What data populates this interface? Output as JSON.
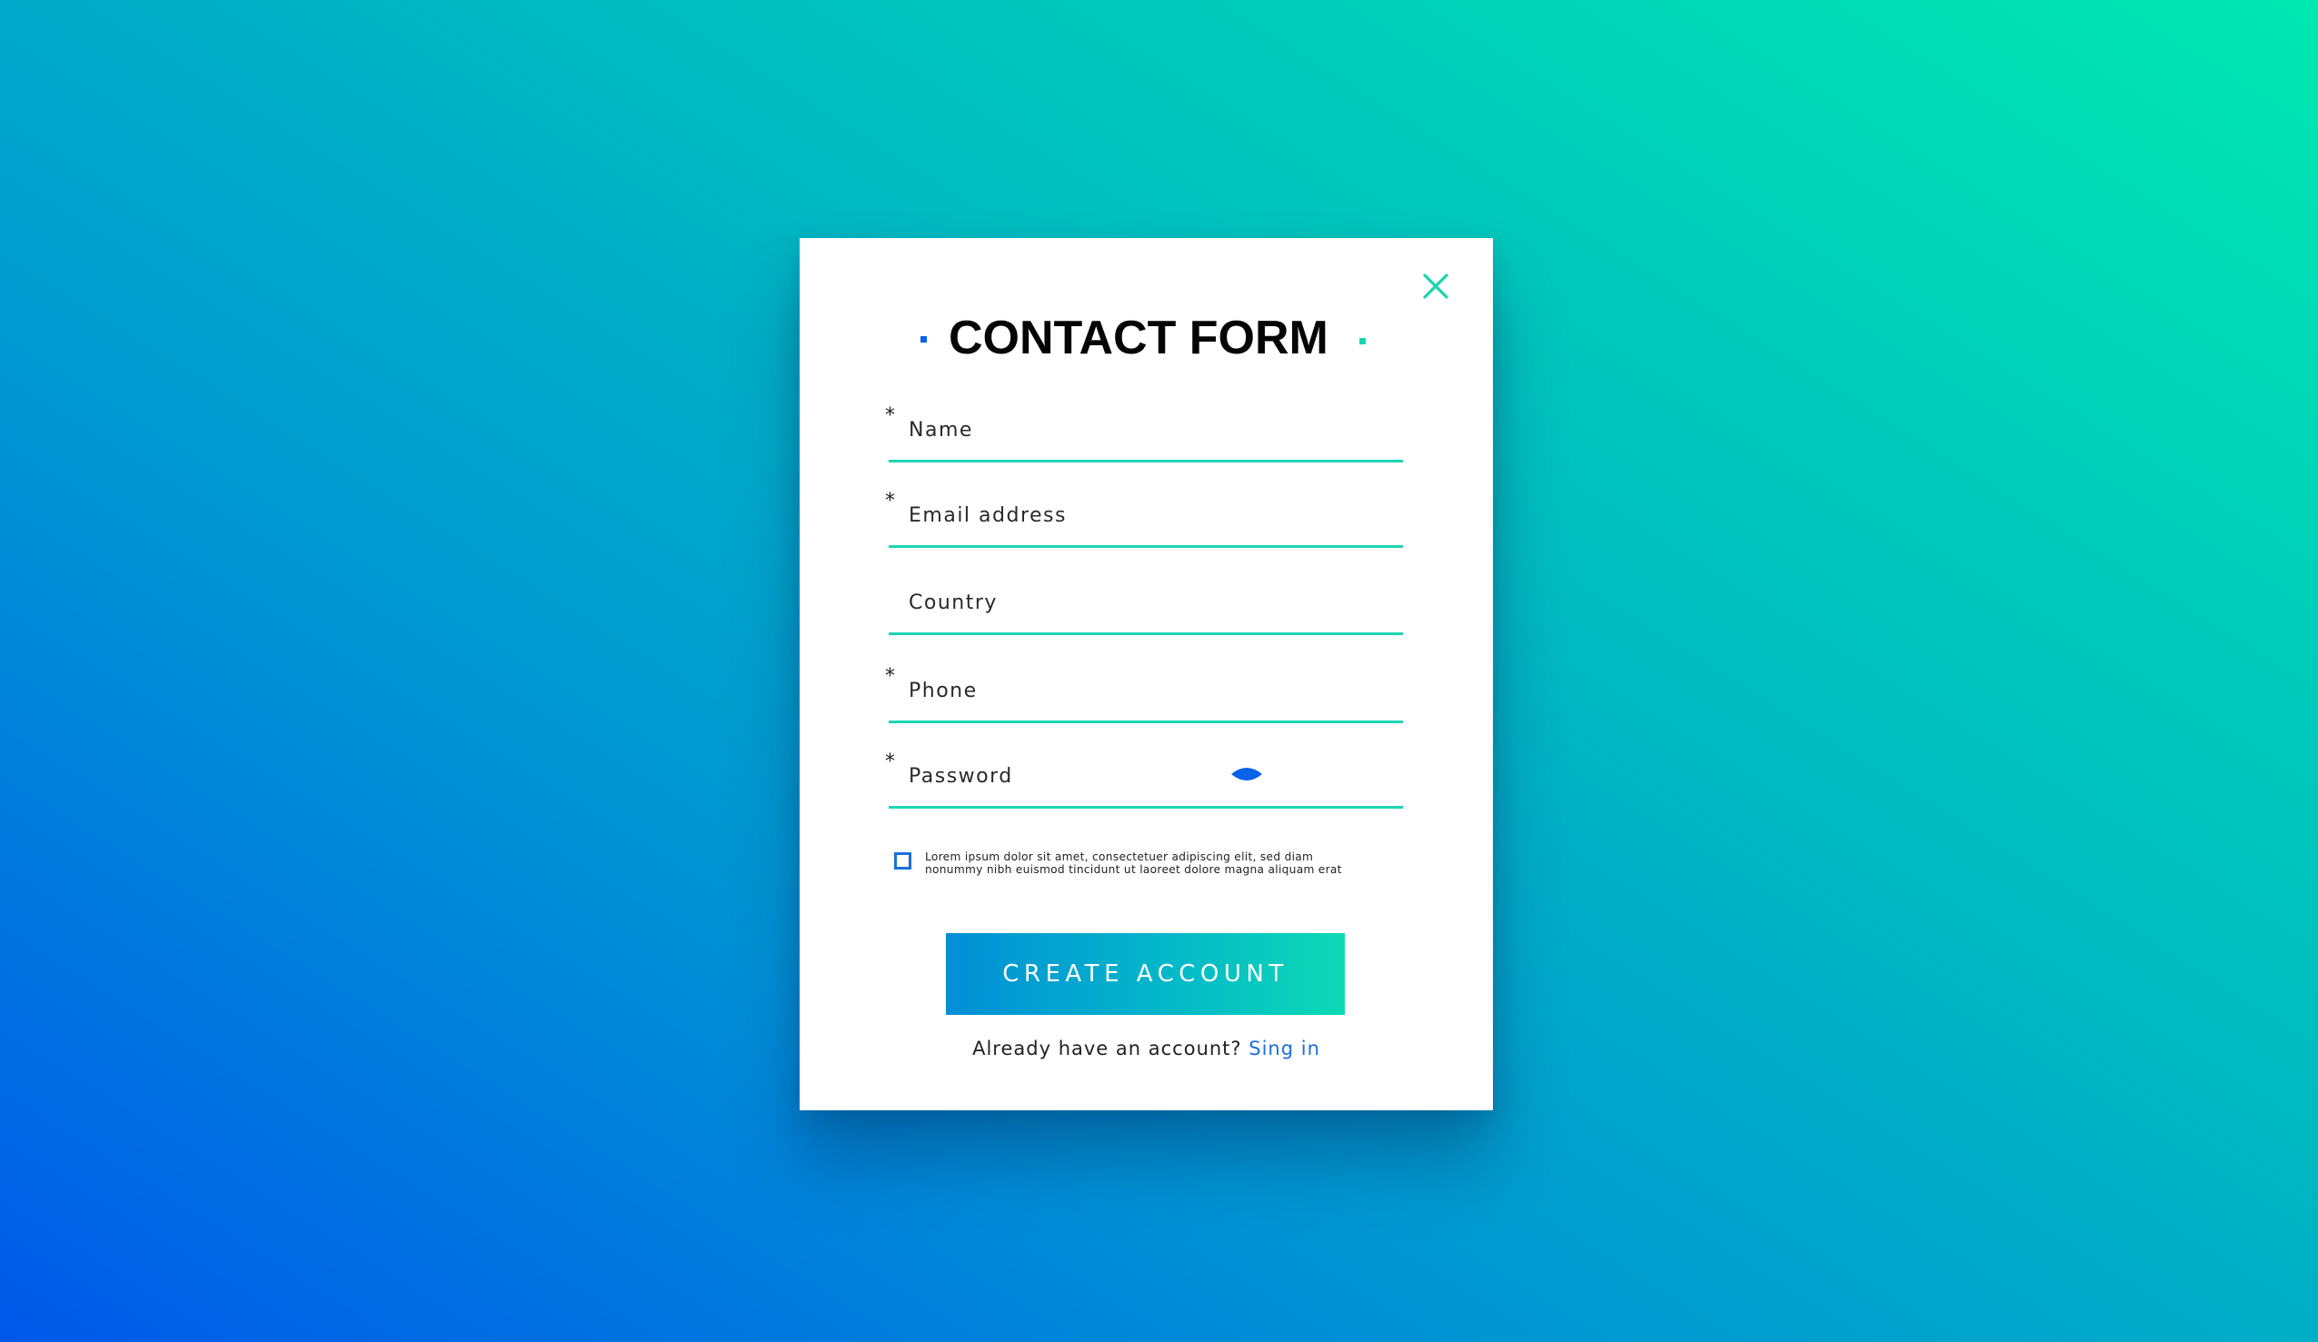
{
  "form": {
    "title": "CONTACT FORM",
    "required_mark": "*",
    "fields": {
      "name": {
        "placeholder": "Name",
        "value": ""
      },
      "email": {
        "placeholder": "Email address",
        "value": ""
      },
      "country": {
        "placeholder": "Country",
        "value": ""
      },
      "phone": {
        "placeholder": "Phone",
        "value": ""
      },
      "password": {
        "placeholder": "Password",
        "value": ""
      }
    },
    "consent": {
      "checked": false,
      "line1": "Lorem ipsum dolor sit amet, consectetuer adipiscing elit, sed diam",
      "line2": "nonummy nibh euismod tincidunt ut laoreet dolore magna aliquam erat"
    },
    "create_button_label": "CREATE ACCOUNT",
    "signin_prompt": "Already have an account?",
    "signin_link_label": "Sing in"
  },
  "icons": {
    "close": "close-icon",
    "password_toggle": "eye-icon"
  },
  "colors": {
    "accent_teal": "#1fd6b5",
    "accent_blue": "#1d6fe0",
    "button_gradient_start": "#028ed7",
    "button_gradient_end": "#0dd9b4",
    "background_gradient_start": "#0058ea",
    "background_gradient_end": "#00e8b1"
  }
}
